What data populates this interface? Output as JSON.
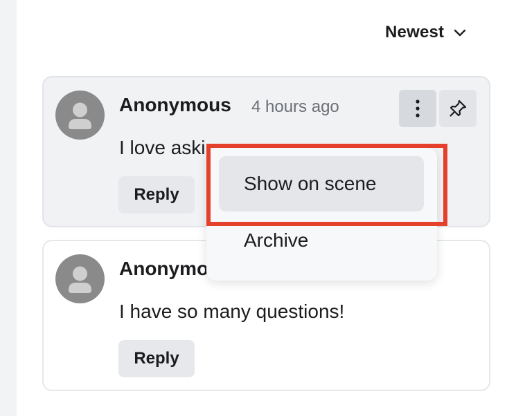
{
  "sort": {
    "label": "Newest"
  },
  "comments": [
    {
      "author": "Anonymous",
      "time": "4 hours ago",
      "text": "I love aski",
      "reply_label": "Reply"
    },
    {
      "author": "Anonymo",
      "text": "I have so many questions!",
      "reply_label": "Reply"
    }
  ],
  "menu": {
    "items": [
      "Show on scene",
      "Archive"
    ],
    "active_index": 0
  },
  "colors": {
    "highlight": "#e5402b",
    "avatar": "#8a8a8a",
    "button_bg": "#e6e8eb"
  },
  "icons": {
    "sort": "chevron-down-icon",
    "more": "kebab-icon",
    "pin": "pin-icon",
    "avatar": "user-icon"
  }
}
